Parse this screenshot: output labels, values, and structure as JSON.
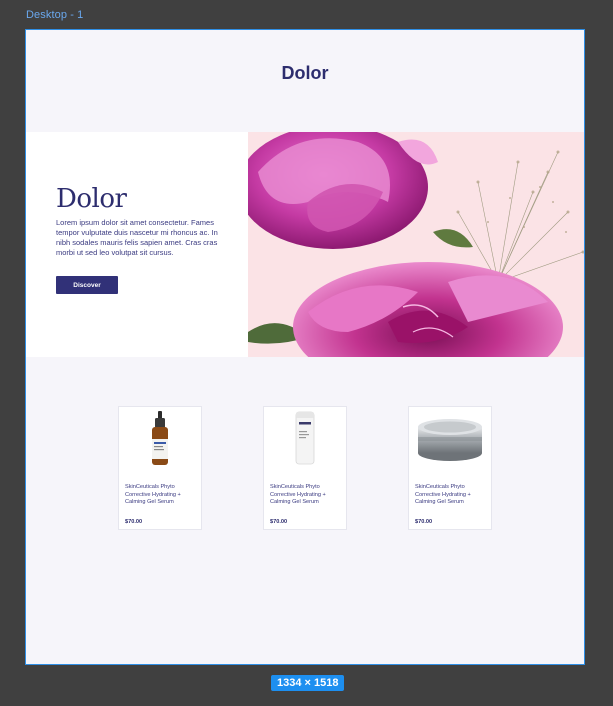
{
  "frame": {
    "label": "Desktop - 1"
  },
  "page": {
    "title": "Dolor"
  },
  "hero": {
    "heading": "Dolor",
    "body": "Lorem ipsum dolor sit amet consectetur. Fames tempor vulputate duis nascetur mi rhoncus ac. In nibh sodales mauris felis sapien amet. Cras cras morbi ut sed leo volutpat sit cursus.",
    "button_label": "Discover",
    "image_icon": "peony-flower-photo"
  },
  "products": [
    {
      "name": "SkinCeuticals Phyto Corrective Hydrating + Calming Gel Serum",
      "price": "$70.00",
      "image_icon": "dropper-bottle-icon"
    },
    {
      "name": "SkinCeuticals Phyto Corrective Hydrating + Calming Gel Serum",
      "price": "$70.00",
      "image_icon": "pump-bottle-icon"
    },
    {
      "name": "SkinCeuticals Phyto Corrective Hydrating + Calming Gel Serum",
      "price": "$70.00",
      "image_icon": "cream-jar-icon"
    }
  ],
  "canvas": {
    "size_label": "1334 × 1518"
  },
  "colors": {
    "accent": "#313178",
    "selection": "#1d8ff0",
    "background": "#f6f5fa"
  }
}
